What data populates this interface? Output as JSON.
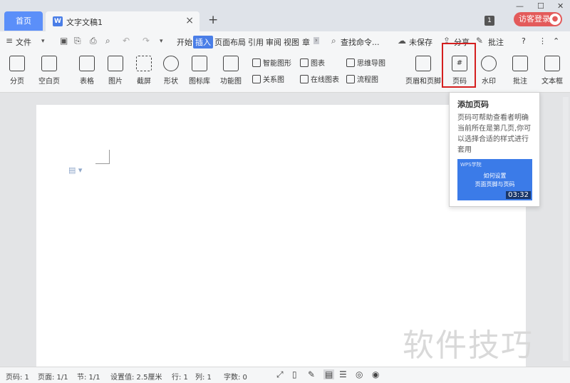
{
  "titlebar": {
    "home_tab": "首页",
    "doc_tab": "文字文稿1",
    "doc_icon": "W",
    "close_glyph": "×",
    "add_glyph": "+",
    "badge": "1",
    "login": "访客登录",
    "win_min": "—",
    "win_max": "☐",
    "win_close": "✕"
  },
  "menubar": {
    "file": "文件",
    "tabs": [
      "开始",
      "插入",
      "页面布局",
      "引用",
      "审阅",
      "视图",
      "章"
    ],
    "search": "查找命令...",
    "unsaved": "未保存",
    "share": "分享",
    "comment": "批注",
    "help": "?"
  },
  "ribbon": {
    "page_break": "分页",
    "blank_page": "空白页",
    "table": "表格",
    "picture": "图片",
    "screenshot": "截屏",
    "shape": "形状",
    "icon_lib": "图标库",
    "func_chart": "功能图",
    "smart_shape": "智能图形",
    "chart": "图表",
    "mindmap": "思维导图",
    "relation": "关系图",
    "online_chart": "在线图表",
    "flowchart": "流程图",
    "header_footer": "页眉和页脚",
    "page_number": "页码",
    "watermark": "水印",
    "comment": "批注",
    "textbox": "文本框"
  },
  "tooltip": {
    "title": "添加页码",
    "desc": "页码可帮助查看者明确当前所在是第几页,你可以选择合适的样式进行套用",
    "thumb_logo": "WPS学院",
    "thumb_caption": "如何设置\n页面页脚与页码",
    "duration": "03:32"
  },
  "statusbar": {
    "page_num": "页码: 1",
    "pages": "页面: 1/1",
    "section": "节: 1/1",
    "setting": "设置值: 2.5厘米",
    "row": "行: 1",
    "col": "列: 1",
    "words": "字数: 0"
  },
  "watermark_text": "软件技巧"
}
